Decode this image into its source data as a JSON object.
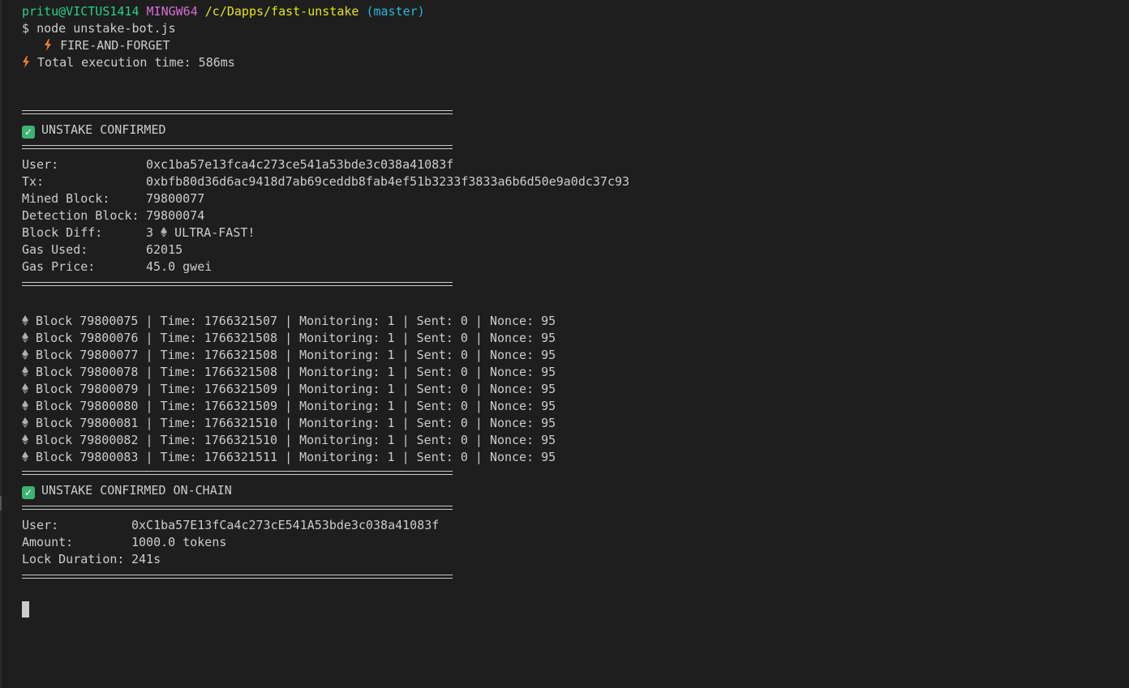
{
  "prompt": {
    "user": "pritu@VICTUS1414",
    "shell": "MINGW64",
    "path": "/c/Dapps/fast-unstake",
    "branch": "(master)",
    "symbol": "$",
    "command": "node unstake-bot.js"
  },
  "intro": {
    "mode": "FIRE-AND-FORGET",
    "exec_time": "Total execution time: 586ms"
  },
  "confirm1": {
    "title": "UNSTAKE CONFIRMED",
    "fields": [
      {
        "key": "User:",
        "value": "0xc1ba57e13fca4c273ce541a53bde3c038a41083f"
      },
      {
        "key": "Tx:",
        "value": "0xbfb80d36d6ac9418d7ab69ceddb8fab4ef51b3233f3833a6b6d50e9a0dc37c93"
      },
      {
        "key": "Mined Block:",
        "value": "79800077"
      },
      {
        "key": "Detection Block:",
        "value": "79800074"
      },
      {
        "key": "Block Diff:",
        "value_pre": "3",
        "value_post": "ULTRA-FAST!"
      },
      {
        "key": "Gas Used:",
        "value": "62015"
      },
      {
        "key": "Gas Price:",
        "value": "45.0 gwei"
      }
    ]
  },
  "blocks": [
    "Block 79800075 | Time: 1766321507 | Monitoring: 1 | Sent: 0 | Nonce: 95",
    "Block 79800076 | Time: 1766321508 | Monitoring: 1 | Sent: 0 | Nonce: 95",
    "Block 79800077 | Time: 1766321508 | Monitoring: 1 | Sent: 0 | Nonce: 95",
    "Block 79800078 | Time: 1766321508 | Monitoring: 1 | Sent: 0 | Nonce: 95",
    "Block 79800079 | Time: 1766321509 | Monitoring: 1 | Sent: 0 | Nonce: 95",
    "Block 79800080 | Time: 1766321509 | Monitoring: 1 | Sent: 0 | Nonce: 95",
    "Block 79800081 | Time: 1766321510 | Monitoring: 1 | Sent: 0 | Nonce: 95",
    "Block 79800082 | Time: 1766321510 | Monitoring: 1 | Sent: 0 | Nonce: 95",
    "Block 79800083 | Time: 1766321511 | Monitoring: 1 | Sent: 0 | Nonce: 95"
  ],
  "confirm2": {
    "title": "UNSTAKE CONFIRMED ON-CHAIN",
    "fields": [
      {
        "key": "User:",
        "value": "0xC1ba57E13fCa4c273cE541A53bde3c038a41083f"
      },
      {
        "key": "Amount:",
        "value": "1000.0 tokens"
      },
      {
        "key": "Lock Duration:",
        "value": "241s"
      }
    ]
  },
  "icons": {
    "bolt": "lightning-bolt-icon",
    "check": "check-mark-icon",
    "eth": "ethereum-icon"
  },
  "colors": {
    "background": "#1e1e1e",
    "text": "#cccccc",
    "user": "#23d18b",
    "shell": "#d670d6",
    "path": "#e5e510",
    "branch": "#29b8db",
    "check": "#3cb371",
    "bolt": "#f07e2f"
  }
}
